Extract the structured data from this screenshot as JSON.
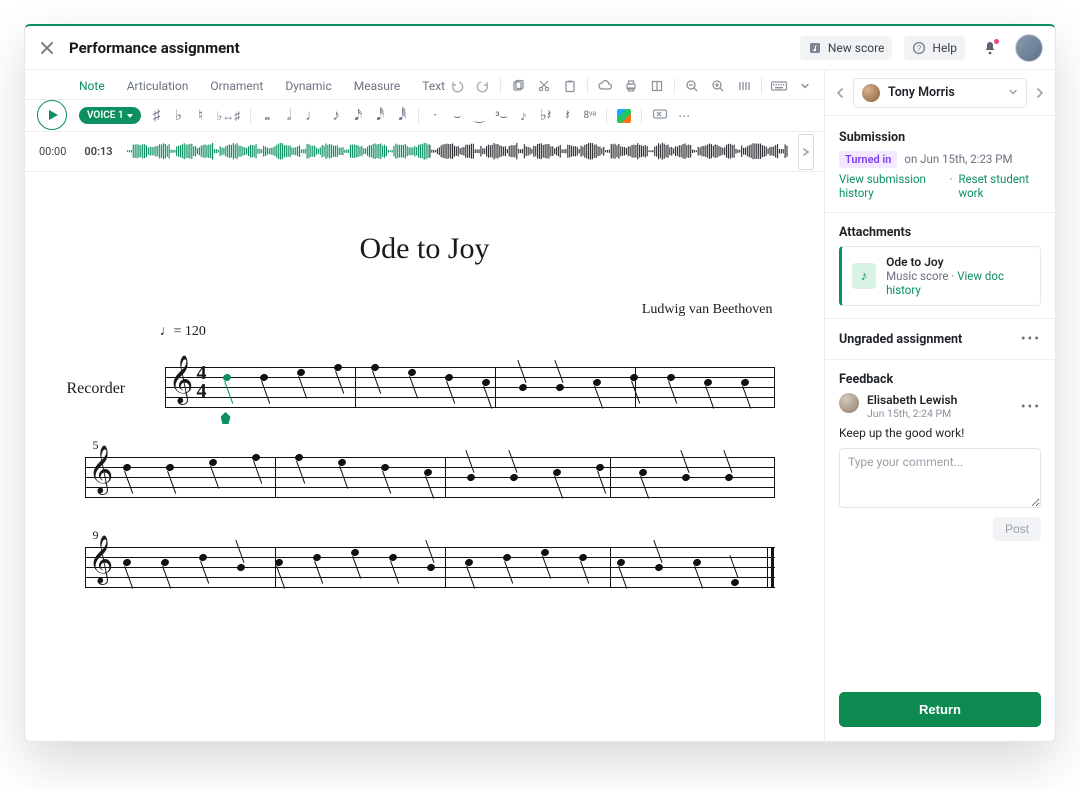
{
  "header": {
    "title": "Performance assignment",
    "new_score": "New score",
    "help": "Help"
  },
  "toolbar": {
    "tabs": [
      "Note",
      "Articulation",
      "Ornament",
      "Dynamic",
      "Measure",
      "Text"
    ],
    "active_tab": 0,
    "voice_label": "VOICE 1",
    "time_start": "00:00",
    "time_end": "00:13"
  },
  "score": {
    "title": "Ode to Joy",
    "composer": "Ludwig van Beethoven",
    "tempo_prefix": "♩= ",
    "tempo_bpm": "120",
    "instrument": "Recorder",
    "timesig_top": "4",
    "timesig_bot": "4",
    "measure_numbers": [
      "5",
      "9"
    ]
  },
  "side": {
    "student_name": "Tony Morris",
    "submission_h": "Submission",
    "status": "Turned in",
    "status_suffix": "on Jun 15th, 2:23 PM",
    "view_history": "View submission history",
    "reset": "Reset student work",
    "attachments_h": "Attachments",
    "attach_title": "Ode to Joy",
    "attach_sub": "Music score · ",
    "attach_link": "View doc history",
    "ungraded": "Ungraded assignment",
    "feedback_h": "Feedback",
    "fb_name": "Elisabeth Lewish",
    "fb_date": "Jun 15th, 2:24 PM",
    "fb_text": "Keep up the good work!",
    "comment_placeholder": "Type your comment...",
    "post": "Post",
    "return": "Return"
  }
}
